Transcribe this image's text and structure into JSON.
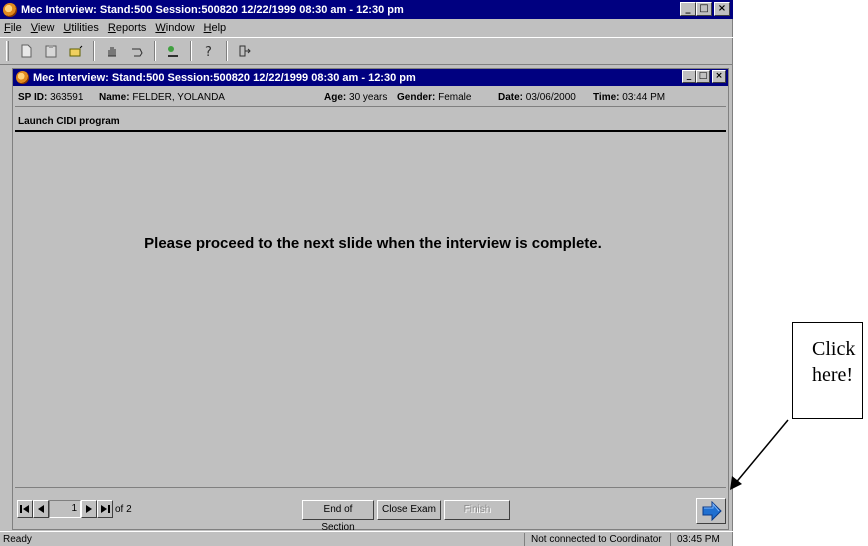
{
  "outer_window": {
    "title": "Mec Interview: Stand:500 Session:500820 12/22/1999 08:30 am - 12:30 pm",
    "controls": {
      "minimize": "_",
      "maximize": "□",
      "close": "×"
    }
  },
  "menu": {
    "items": [
      {
        "first": "F",
        "rest": "ile"
      },
      {
        "first": "V",
        "rest": "iew"
      },
      {
        "first": "U",
        "rest": "tilities"
      },
      {
        "first": "R",
        "rest": "eports"
      },
      {
        "first": "W",
        "rest": "indow"
      },
      {
        "first": "H",
        "rest": "elp"
      }
    ]
  },
  "toolbar": {
    "icons": [
      "new-icon",
      "clipboard-icon",
      "folder-open-icon",
      "hand-icon",
      "undo-icon",
      "tools-icon",
      "help-icon",
      "exit-icon"
    ]
  },
  "child_window": {
    "title": "Mec Interview: Stand:500 Session:500820 12/22/1999 08:30 am - 12:30 pm"
  },
  "participant": {
    "sp_id_label": "SP ID:",
    "sp_id": "363591",
    "name_label": "Name:",
    "name": "FELDER, YOLANDA",
    "age_label": "Age:",
    "age": "30 years",
    "gender_label": "Gender:",
    "gender": "Female",
    "date_label": "Date:",
    "date": "03/06/2000",
    "time_label": "Time:",
    "time": "03:44 PM"
  },
  "section": {
    "title": "Launch CIDI program"
  },
  "message": {
    "text": "Please proceed to the next slide when the interview is complete."
  },
  "navigation": {
    "page": "1",
    "of_text": "of 2"
  },
  "buttons": {
    "end_of_section": "End of Section",
    "close_exam": "Close Exam",
    "finish": "Finish"
  },
  "status": {
    "ready": "Ready",
    "connection": "Not connected to Coordinator",
    "time": "03:45 PM"
  },
  "callout": {
    "line1": "Click",
    "line2": "here!"
  },
  "colors": {
    "titlebar": "#000080",
    "face": "#c0c0c0",
    "next_arrow": "#1f6fd0"
  }
}
